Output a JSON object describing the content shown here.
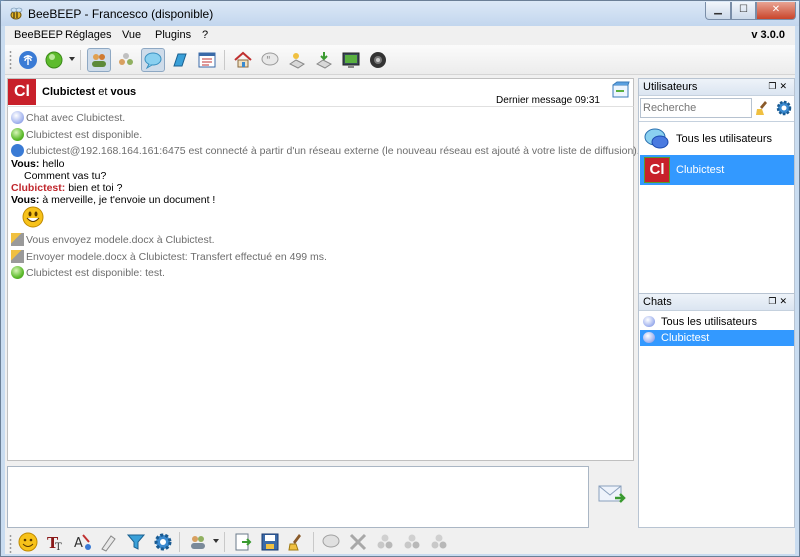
{
  "window": {
    "title": "BeeBEEP - Francesco (disponible)",
    "controls": [
      "minimize",
      "maximize",
      "close"
    ]
  },
  "menu": {
    "items": [
      "BeeBEEP",
      "Réglages",
      "Vue",
      "Plugins",
      "?"
    ],
    "version": "v 3.0.0"
  },
  "toolbar": {
    "icons": [
      "network-icon",
      "status-available-icon",
      "users-view-icon",
      "groups-icon",
      "chat-view-icon",
      "file-transfer-icon",
      "log-icon",
      "home-icon",
      "quote-icon",
      "share-icon",
      "download-icon",
      "screenshot-icon",
      "camera-icon"
    ]
  },
  "chat": {
    "avatar_initials": "Cl",
    "title_bold": "Clubictest",
    "title_connector": "et",
    "title_bold2": "vous",
    "last_message": "Dernier message 09:31",
    "messages": [
      {
        "type": "system",
        "icon": "chat-bubble-icon",
        "text": "Chat avec Clubictest."
      },
      {
        "type": "system",
        "icon": "status-green-icon",
        "text": "Clubictest est disponible."
      },
      {
        "type": "system",
        "icon": "network-icon",
        "text": "clubictest@192.168.164.161:6475 est connecté à partir d'un réseau externe (le nouveau réseau est ajouté à votre liste de diffusion)."
      },
      {
        "type": "me",
        "sender": "Vous:",
        "text": "hello"
      },
      {
        "type": "cont",
        "text": "Comment vas tu?"
      },
      {
        "type": "peer",
        "sender": "Clubictest:",
        "text": "bien et toi ?"
      },
      {
        "type": "me",
        "sender": "Vous:",
        "text": "à merveille, je t'envoie un document !"
      },
      {
        "type": "emoji",
        "icon": "smiley-icon"
      },
      {
        "type": "system",
        "icon": "file-transfer-icon",
        "text": "Vous envoyez modele.docx à Clubictest."
      },
      {
        "type": "system",
        "icon": "file-transfer-icon",
        "text": "Envoyer modele.docx à Clubictest: Transfert effectué en 499 ms."
      },
      {
        "type": "system",
        "icon": "status-green-icon",
        "text": "Clubictest est disponible: test."
      }
    ]
  },
  "users_dock": {
    "title": "Utilisateurs",
    "search_placeholder": "Recherche",
    "items": [
      {
        "label": "Tous les utilisateurs",
        "icon": "all-users-icon",
        "selected": false
      },
      {
        "label": "Clubictest",
        "icon": "avatar",
        "selected": true
      }
    ]
  },
  "chats_dock": {
    "title": "Chats",
    "items": [
      {
        "label": "Tous les utilisateurs",
        "selected": false
      },
      {
        "label": "Clubictest",
        "selected": true
      }
    ]
  },
  "colors": {
    "selection": "#3399ff",
    "peer_name": "#c0272d",
    "system_text": "#6d6d6d",
    "avatar_bg": "#c8202a"
  }
}
